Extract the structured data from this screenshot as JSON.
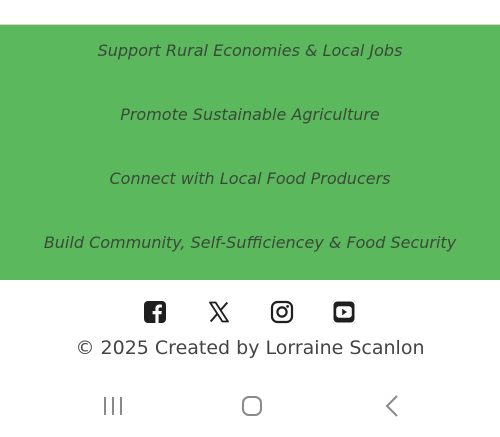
{
  "mission": {
    "items": [
      {
        "label": "Support Rural Economies & Local Jobs"
      },
      {
        "label": "Promote Sustainable Agriculture"
      },
      {
        "label": "Connect with Local Food Producers"
      },
      {
        "label": "Build Community, Self-Sufficiencey & Food Security"
      }
    ]
  },
  "social": {
    "icons": [
      "facebook-icon",
      "x-icon",
      "instagram-icon",
      "youtube-icon"
    ]
  },
  "footer": {
    "copyright": "© 2025 Created by Lorraine Scanlon"
  },
  "colors": {
    "band": "#5cb85c",
    "band_text": "#3a4a3a",
    "icon": "#1f1f1f",
    "nav": "#8a8a8a"
  }
}
